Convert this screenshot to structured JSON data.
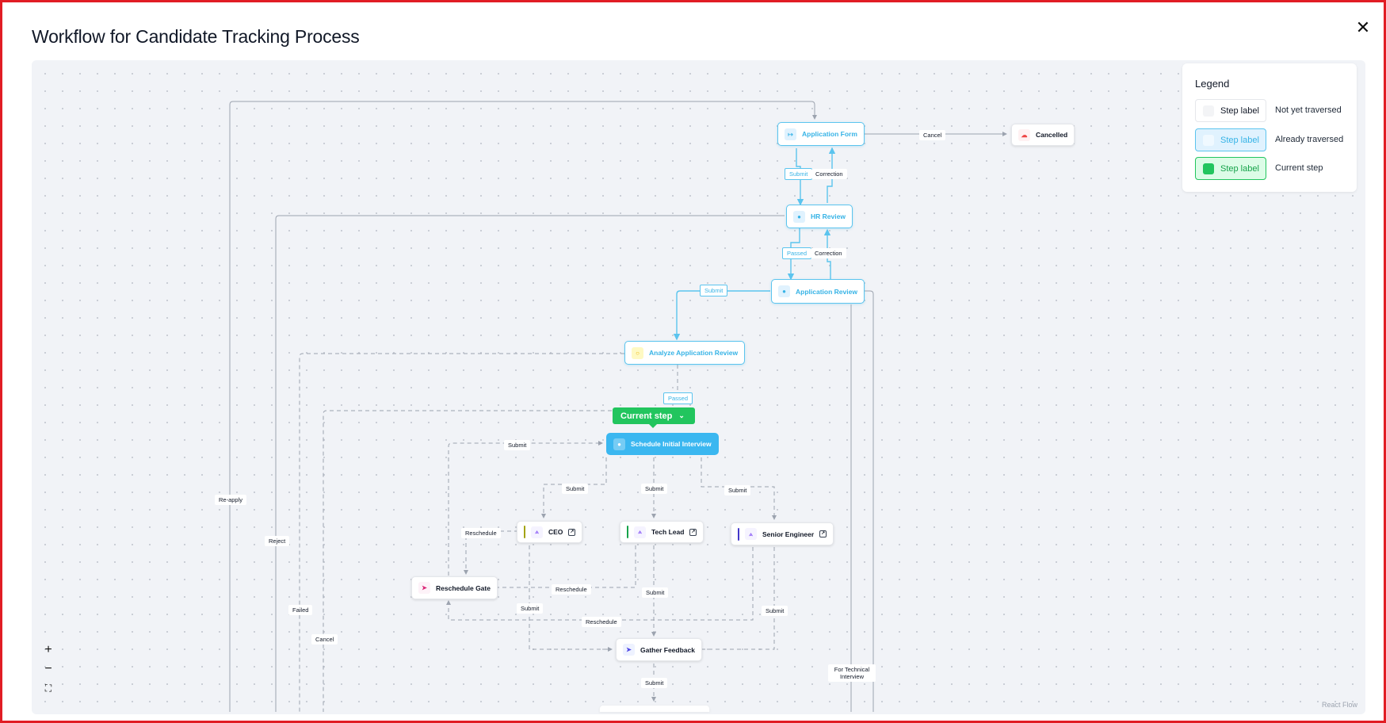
{
  "title": "Workflow for Candidate Tracking Process",
  "close_icon": "close-icon",
  "legend": {
    "title": "Legend",
    "items": [
      {
        "chip": "Step label",
        "text": "Not yet traversed",
        "color": "#f3f4f6"
      },
      {
        "chip": "Step label",
        "text": "Already traversed",
        "color": "#e0f2fe"
      },
      {
        "chip": "Step label",
        "text": "Current step",
        "color": "#22c55e"
      }
    ]
  },
  "current_step_badge": "Current step",
  "nodes": {
    "application_form": "Application Form",
    "cancelled": "Cancelled",
    "hr_review": "HR Review",
    "application_review": "Application Review",
    "analyze_application_review": "Analyze Application Review",
    "schedule_initial_interview": "Schedule Initial Interview",
    "ceo": "CEO",
    "tech_lead": "Tech Lead",
    "senior_engineer": "Senior Engineer",
    "reschedule_gate": "Reschedule Gate",
    "gather_feedback": "Gather Feedback"
  },
  "edge_labels": {
    "cancel_top": "Cancel",
    "submit_1": "Submit",
    "correction_1": "Correction",
    "passed_1": "Passed",
    "correction_2": "Correction",
    "submit_2": "Submit",
    "passed_2": "Passed",
    "submit_left": "Submit",
    "submit_ceo": "Submit",
    "submit_tl": "Submit",
    "submit_se": "Submit",
    "reapply": "Re-apply",
    "reject": "Reject",
    "reschedule_ceo": "Reschedule",
    "reschedule_tl": "Reschedule",
    "submit_tl_down": "Submit",
    "submit_ceo_down": "Submit",
    "submit_se_down": "Submit",
    "reschedule_se": "Reschedule",
    "failed": "Failed",
    "cancel_bottom": "Cancel",
    "submit_gf": "Submit",
    "for_technical_interview": "For Technical Interview"
  },
  "zoom_controls": {
    "zoom_in": "+",
    "zoom_out": "−",
    "fit": "⛶"
  },
  "attribution": "React Flow",
  "colors": {
    "traversed": "#5bc4ee",
    "current": "#3bb7f0",
    "current_badge": "#22c55e",
    "frame": "#e11d24"
  }
}
